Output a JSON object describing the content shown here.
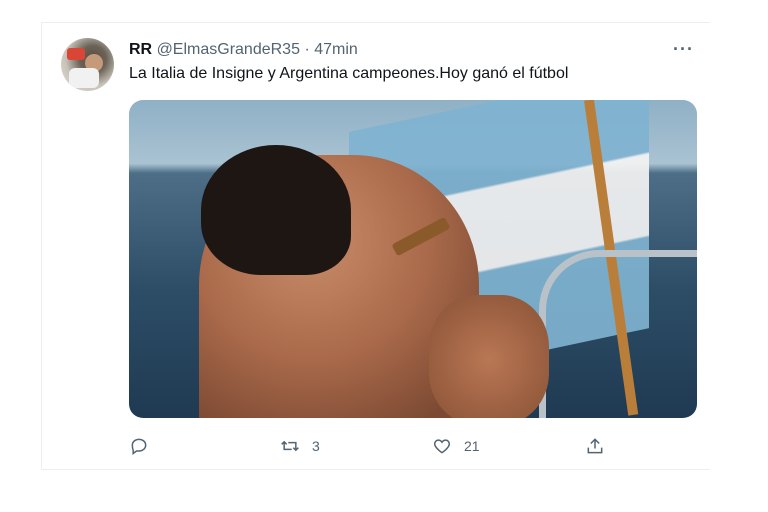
{
  "tweet": {
    "name": "RR",
    "handle": "@ElmasGrandeR35",
    "separator": "·",
    "time": "47min",
    "text": "La Italia de Insigne y Argentina campeones.Hoy ganó el fútbol",
    "more_label": "···",
    "actions": {
      "reply_count": "",
      "retweet_count": "3",
      "like_count": "21"
    }
  },
  "icons": [
    "reply-icon",
    "retweet-icon",
    "like-icon",
    "share-icon",
    "more-icon"
  ],
  "colors": {
    "text_primary": "#0f1419",
    "text_secondary": "#536471",
    "border": "#eceff1"
  }
}
